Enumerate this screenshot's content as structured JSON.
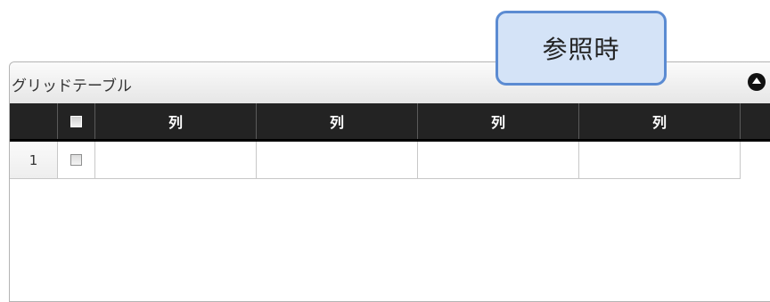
{
  "callout": {
    "label": "参照時"
  },
  "panel": {
    "title": "グリッドテーブル",
    "collapse_icon": "triangle-up-circle-icon"
  },
  "grid": {
    "columns": [
      "列",
      "列",
      "列",
      "列"
    ],
    "rows": [
      {
        "row_number": "1",
        "checked": false,
        "cells": [
          "",
          "",
          "",
          ""
        ]
      }
    ],
    "select_all_checked": false
  }
}
